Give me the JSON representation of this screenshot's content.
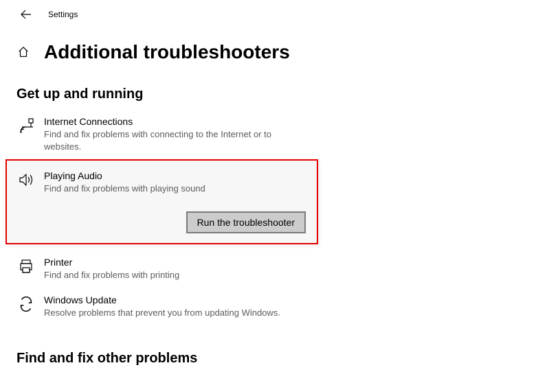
{
  "topbar": {
    "app_title": "Settings"
  },
  "header": {
    "page_title": "Additional troubleshooters"
  },
  "section1_heading": "Get up and running",
  "items": {
    "internet": {
      "title": "Internet Connections",
      "desc": "Find and fix problems with connecting to the Internet or to websites."
    },
    "audio": {
      "title": "Playing Audio",
      "desc": "Find and fix problems with playing sound",
      "run_label": "Run the troubleshooter"
    },
    "printer": {
      "title": "Printer",
      "desc": "Find and fix problems with printing"
    },
    "update": {
      "title": "Windows Update",
      "desc": "Resolve problems that prevent you from updating Windows."
    }
  },
  "section2_heading": "Find and fix other problems"
}
